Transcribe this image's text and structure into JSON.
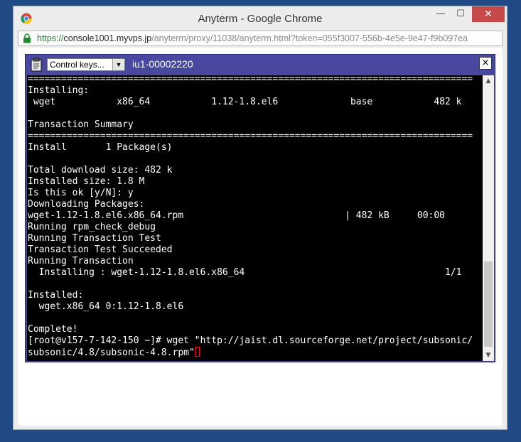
{
  "browser": {
    "title": "Anyterm - Google Chrome",
    "controls": {
      "minimize": "—",
      "maximize": "☐",
      "close": "✕"
    },
    "url_scheme": "https://",
    "url_host": "console1001.myvps.jp",
    "url_rest": "/anyterm/proxy/11038/anyterm.html?token=055f3007-556b-4e5e-9e47-f9b097ea"
  },
  "terminal": {
    "control_keys_label": "Control keys...",
    "title": "iu1-00002220",
    "close_label": "×",
    "lines": [
      "================================================================================",
      "Installing:",
      " wget           x86_64           1.12-1.8.el6             base           482 k",
      "",
      "Transaction Summary",
      "================================================================================",
      "Install       1 Package(s)",
      "",
      "Total download size: 482 k",
      "Installed size: 1.8 M",
      "Is this ok [y/N]: y",
      "Downloading Packages:",
      "wget-1.12-1.8.el6.x86_64.rpm                             | 482 kB     00:00",
      "Running rpm_check_debug",
      "Running Transaction Test",
      "Transaction Test Succeeded",
      "Running Transaction",
      "  Installing : wget-1.12-1.8.el6.x86_64                                    1/1",
      "",
      "Installed:",
      "  wget.x86_64 0:1.12-1.8.el6",
      "",
      "Complete!",
      "[root@v157-7-142-150 ~]# wget \"http://jaist.dl.sourceforge.net/project/subsonic/",
      "subsonic/4.8/subsonic-4.8.rpm\""
    ]
  },
  "icons": {
    "browser_logo": "chrome-icon",
    "secure": "lock-icon",
    "clipboard": "clipboard-icon",
    "scroll_up": "chevron-up-icon",
    "scroll_down": "chevron-down-icon"
  },
  "colors": {
    "desktop": "#1f4a86",
    "terminal_bar": "#4848a0",
    "terminal_bg": "#000000",
    "terminal_fg": "#ffffff",
    "cursor": "#ee1111",
    "url_scheme": "#1e8a2c"
  }
}
